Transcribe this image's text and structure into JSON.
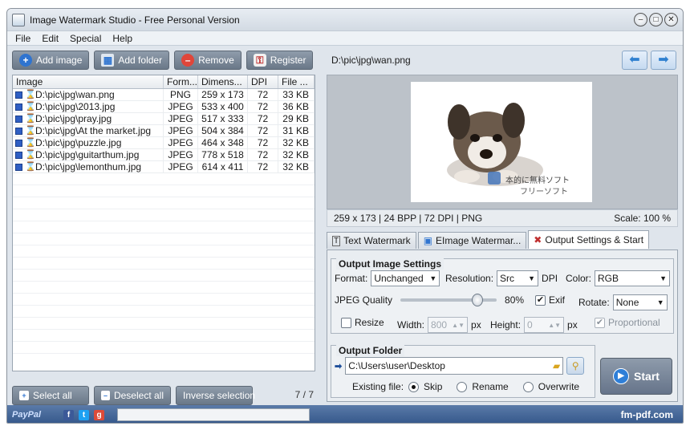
{
  "window": {
    "title": "Image Watermark Studio - Free Personal Version"
  },
  "menu": [
    "File",
    "Edit",
    "Special",
    "Help"
  ],
  "toolbar": {
    "add_image": "Add image",
    "add_folder": "Add folder",
    "remove": "Remove",
    "register": "Register"
  },
  "table": {
    "headers": [
      "Image",
      "Form...",
      "Dimens...",
      "DPI",
      "File ..."
    ],
    "rows": [
      {
        "path": "D:\\pic\\jpg\\wan.png",
        "format": "PNG",
        "dims": "259 x 173",
        "dpi": "72",
        "size": "33 KB"
      },
      {
        "path": "D:\\pic\\jpg\\2013.jpg",
        "format": "JPEG",
        "dims": "533 x 400",
        "dpi": "72",
        "size": "36 KB"
      },
      {
        "path": "D:\\pic\\jpg\\pray.jpg",
        "format": "JPEG",
        "dims": "517 x 333",
        "dpi": "72",
        "size": "29 KB"
      },
      {
        "path": "D:\\pic\\jpg\\At the market.jpg",
        "format": "JPEG",
        "dims": "504 x 384",
        "dpi": "72",
        "size": "31 KB"
      },
      {
        "path": "D:\\pic\\jpg\\puzzle.jpg",
        "format": "JPEG",
        "dims": "464 x 348",
        "dpi": "72",
        "size": "32 KB"
      },
      {
        "path": "D:\\pic\\jpg\\guitarthum.jpg",
        "format": "JPEG",
        "dims": "778 x 518",
        "dpi": "72",
        "size": "32 KB"
      },
      {
        "path": "D:\\pic\\jpg\\lemonthum.jpg",
        "format": "JPEG",
        "dims": "614 x 411",
        "dpi": "72",
        "size": "32 KB"
      }
    ]
  },
  "selection": {
    "select_all": "Select all",
    "deselect_all": "Deselect all",
    "inverse": "Inverse selection",
    "count": "7 / 7"
  },
  "preview": {
    "path": "D:\\pic\\jpg\\wan.png",
    "info": "259 x 173 | 24 BPP | 72 DPI | PNG",
    "scale": "Scale: 100 %",
    "watermark_line1": "本的に無料ソフト",
    "watermark_line2": "フリーソフト"
  },
  "tabs": [
    "Text Watermark",
    "EImage Watermar...",
    "Output Settings & Start"
  ],
  "output_settings": {
    "title": "Output Image Settings",
    "format_label": "Format:",
    "format_value": "Unchanged",
    "resolution_label": "Resolution:",
    "resolution_value": "Src",
    "dpi_label": "DPI",
    "color_label": "Color:",
    "color_value": "RGB",
    "quality_label": "JPEG Quality",
    "quality_value": "80%",
    "quality_fraction": 0.8,
    "exif_label": "Exif",
    "rotate_label": "Rotate:",
    "rotate_value": "None",
    "resize_label": "Resize",
    "width_label": "Width:",
    "width_value": "800",
    "px1": "px",
    "height_label": "Height:",
    "height_value": "0",
    "px2": "px",
    "proportional_label": "Proportional"
  },
  "output_folder": {
    "title": "Output Folder",
    "path": "C:\\Users\\user\\Desktop",
    "existing_label": "Existing file:",
    "skip": "Skip",
    "rename": "Rename",
    "overwrite": "Overwrite"
  },
  "start_label": "Start",
  "status": {
    "paypal": "PayPal",
    "site": "fm-pdf.com"
  }
}
